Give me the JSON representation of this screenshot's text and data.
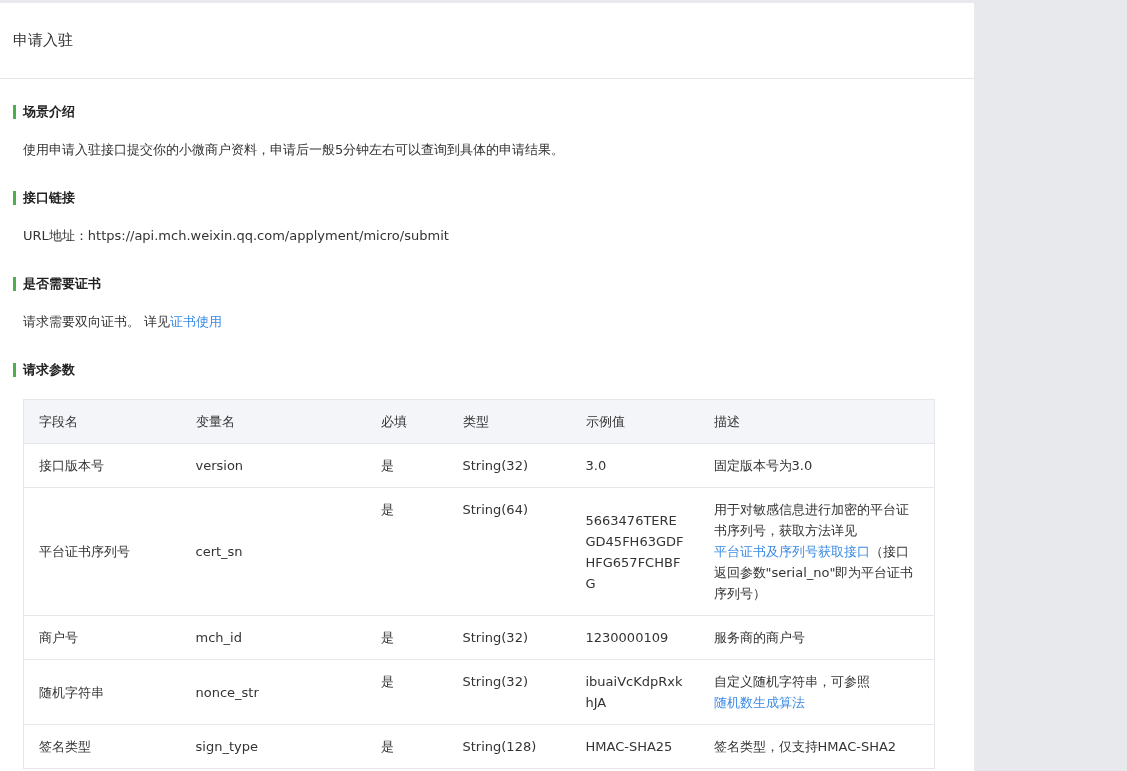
{
  "page_title": "申请入驻",
  "sections": [
    {
      "heading": "场景介绍",
      "kind": "text",
      "segments": [
        {
          "text": "使用申请入驻接口提交你的小微商户资料，申请后一般5分钟左右可以查询到具体的申请结果。",
          "link": false
        }
      ]
    },
    {
      "heading": "接口链接",
      "kind": "text",
      "segments": [
        {
          "text": "URL地址：https://api.mch.weixin.qq.com/applyment/micro/submit",
          "link": false
        }
      ]
    },
    {
      "heading": "是否需要证书",
      "kind": "text",
      "segments": [
        {
          "text": "请求需要双向证书。 详见",
          "link": false
        },
        {
          "text": "证书使用",
          "link": true
        }
      ]
    },
    {
      "heading": "请求参数",
      "kind": "table",
      "table": {
        "columns": [
          "字段名",
          "变量名",
          "必填",
          "类型",
          "示例值",
          "描述"
        ],
        "rows": [
          {
            "field": "接口版本号",
            "variable": "version",
            "required": "是",
            "type": "String(32)",
            "example": "3.0",
            "description": [
              {
                "text": "固定版本号为3.0",
                "link": false
              }
            ]
          },
          {
            "field": "平台证书序列号",
            "variable": "cert_sn",
            "required": "是",
            "type": "String(64)",
            "example": "5663476TEREGD45FH63GDFHFG657FCHBFG",
            "description": [
              {
                "text": "用于对敏感信息进行加密的平台证书序列号，获取方法详见",
                "link": false
              },
              {
                "text": "平台证书及序列号获取接口",
                "link": true
              },
              {
                "text": "（接口返回参数\"serial_no\"即为平台证书序列号）",
                "link": false
              }
            ]
          },
          {
            "field": "商户号",
            "variable": "mch_id",
            "required": "是",
            "type": "String(32)",
            "example": "1230000109",
            "description": [
              {
                "text": "服务商的商户号",
                "link": false
              }
            ]
          },
          {
            "field": "随机字符串",
            "variable": "nonce_str",
            "required": "是",
            "type": "String(32)",
            "example": "ibuaiVcKdpRxkhJA",
            "description": [
              {
                "text": "自定义随机字符串，可参照",
                "link": false
              },
              {
                "text": "随机数生成算法",
                "link": true
              }
            ]
          },
          {
            "field": "签名类型",
            "variable": "sign_type",
            "required": "是",
            "type": "String(128)",
            "example": "HMAC-SHA25",
            "description": [
              {
                "text": "签名类型，仅支持HMAC-SHA2",
                "link": false
              }
            ]
          }
        ]
      }
    }
  ]
}
